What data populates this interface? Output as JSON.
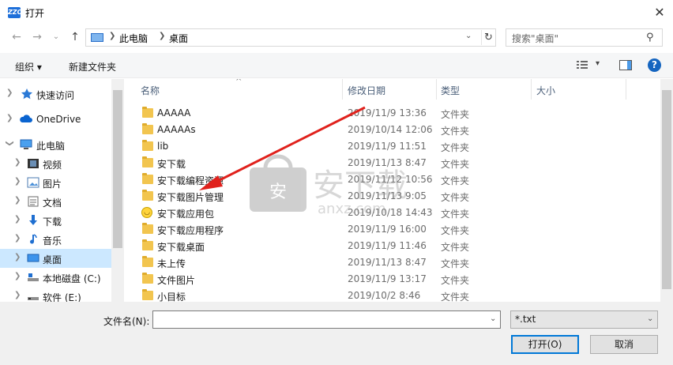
{
  "window": {
    "title": "打开",
    "app_icon_text": "ZZO"
  },
  "address": {
    "crumbs": [
      "此电脑",
      "桌面"
    ],
    "search_placeholder": "搜索\"桌面\""
  },
  "toolbar": {
    "organize": "组织 ▾",
    "new_folder": "新建文件夹"
  },
  "nav": {
    "items": [
      {
        "label": "快速访问",
        "icon": "star-icon"
      },
      {
        "label": "OneDrive",
        "icon": "cloud-icon"
      },
      {
        "label": "此电脑",
        "icon": "computer-icon"
      },
      {
        "label": "视频",
        "icon": "video-icon"
      },
      {
        "label": "图片",
        "icon": "picture-icon"
      },
      {
        "label": "文档",
        "icon": "document-icon"
      },
      {
        "label": "下载",
        "icon": "download-icon"
      },
      {
        "label": "音乐",
        "icon": "music-icon"
      },
      {
        "label": "桌面",
        "icon": "desktop-icon"
      },
      {
        "label": "本地磁盘 (C:)",
        "icon": "drive-icon"
      },
      {
        "label": "软件 (E:)",
        "icon": "drive-icon"
      }
    ]
  },
  "columns": {
    "name": "名称",
    "date": "修改日期",
    "type": "类型",
    "size": "大小"
  },
  "files": [
    {
      "name": "AAAAA",
      "date": "2019/11/9 13:36",
      "type": "文件夹",
      "icon": "folder-icon"
    },
    {
      "name": "AAAAAs",
      "date": "2019/10/14 12:06",
      "type": "文件夹",
      "icon": "folder-icon"
    },
    {
      "name": "lib",
      "date": "2019/11/9 11:51",
      "type": "文件夹",
      "icon": "folder-icon"
    },
    {
      "name": "安下载",
      "date": "2019/11/13 8:47",
      "type": "文件夹",
      "icon": "folder-icon"
    },
    {
      "name": "安下载编程资源",
      "date": "2019/11/12 10:56",
      "type": "文件夹",
      "icon": "folder-icon"
    },
    {
      "name": "安下载图片管理",
      "date": "2019/11/13 9:05",
      "type": "文件夹",
      "icon": "folder-icon"
    },
    {
      "name": "安下载应用包",
      "date": "2019/10/18 14:43",
      "type": "文件夹",
      "icon": "smiley-folder-icon"
    },
    {
      "name": "安下载应用程序",
      "date": "2019/11/9 16:00",
      "type": "文件夹",
      "icon": "folder-icon"
    },
    {
      "name": "安下载桌面",
      "date": "2019/11/9 11:46",
      "type": "文件夹",
      "icon": "folder-icon"
    },
    {
      "name": "未上传",
      "date": "2019/11/13 8:47",
      "type": "文件夹",
      "icon": "folder-icon"
    },
    {
      "name": "文件图片",
      "date": "2019/11/9 13:17",
      "type": "文件夹",
      "icon": "folder-icon"
    },
    {
      "name": "小目标",
      "date": "2019/10/2 8:46",
      "type": "文件夹",
      "icon": "folder-icon"
    }
  ],
  "footer": {
    "filename_label": "文件名(N):",
    "filename_value": "",
    "filetype": "*.txt",
    "open": "打开(O)",
    "cancel": "取消"
  },
  "watermark": {
    "text": "安下载",
    "sub": "anxz.com"
  },
  "colors": {
    "accent": "#0078d7",
    "selection": "#cce8ff",
    "arrow": "#e0211c",
    "folder": "#f2c54f"
  }
}
